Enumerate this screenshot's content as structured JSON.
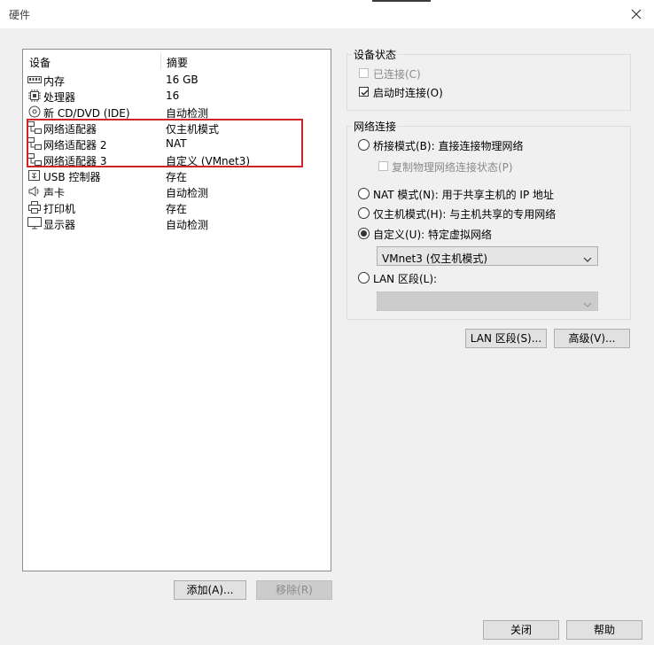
{
  "window": {
    "title": "硬件"
  },
  "device_list": {
    "columns": {
      "device": "设备",
      "summary": "摘要"
    },
    "rows": [
      {
        "name": "内存",
        "summary": "16 GB",
        "icon": "memory-icon"
      },
      {
        "name": "处理器",
        "summary": "16",
        "icon": "processor-icon"
      },
      {
        "name": "新 CD/DVD (IDE)",
        "summary": "自动检测",
        "icon": "cd-dvd-icon"
      },
      {
        "name": "网络适配器",
        "summary": "仅主机模式",
        "icon": "network-adapter-icon"
      },
      {
        "name": "网络适配器 2",
        "summary": "NAT",
        "icon": "network-adapter-icon"
      },
      {
        "name": "网络适配器 3",
        "summary": "自定义 (VMnet3)",
        "icon": "network-adapter-icon"
      },
      {
        "name": "USB 控制器",
        "summary": "存在",
        "icon": "usb-icon"
      },
      {
        "name": "声卡",
        "summary": "自动检测",
        "icon": "speaker-icon"
      },
      {
        "name": "打印机",
        "summary": "存在",
        "icon": "printer-icon"
      },
      {
        "name": "显示器",
        "summary": "自动检测",
        "icon": "display-icon"
      }
    ]
  },
  "list_buttons": {
    "add": "添加(A)...",
    "remove": "移除(R)"
  },
  "device_status": {
    "group_label": "设备状态",
    "connected": {
      "label": "已连接(C)",
      "checked": false,
      "enabled": false
    },
    "connect_at_power_on": {
      "label": "启动时连接(O)",
      "checked": true,
      "enabled": true
    }
  },
  "network_connection": {
    "group_label": "网络连接",
    "bridged": {
      "label": "桥接模式(B): 直接连接物理网络",
      "selected": false
    },
    "replicate_state": {
      "label": "复制物理网络连接状态(P)",
      "checked": false,
      "enabled": false
    },
    "nat": {
      "label": "NAT 模式(N): 用于共享主机的 IP 地址",
      "selected": false
    },
    "host_only": {
      "label": "仅主机模式(H): 与主机共享的专用网络",
      "selected": false
    },
    "custom": {
      "label": "自定义(U): 特定虚拟网络",
      "selected": true
    },
    "custom_select_value": "VMnet3 (仅主机模式)",
    "lan_segment": {
      "label": "LAN 区段(L):",
      "selected": false
    },
    "lan_select_value": ""
  },
  "network_buttons": {
    "lan_segments": "LAN 区段(S)...",
    "advanced": "高级(V)..."
  },
  "footer_buttons": {
    "close": "关闭",
    "help": "帮助"
  },
  "colors": {
    "highlight": "#d2232a",
    "background": "#f0f0f0"
  }
}
